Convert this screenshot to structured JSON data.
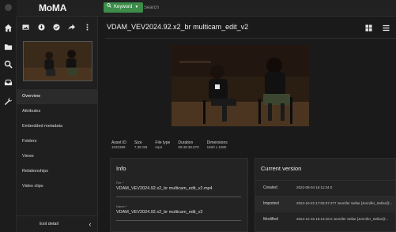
{
  "app": {
    "brand": "MoMA"
  },
  "search": {
    "scope_label": "Keyword",
    "placeholder": "Search"
  },
  "rail": {
    "items": [
      {
        "icon": "home-icon"
      },
      {
        "icon": "folder-icon"
      },
      {
        "icon": "search-icon"
      },
      {
        "icon": "inbox-icon"
      },
      {
        "icon": "tools-icon"
      }
    ]
  },
  "detail_sidebar": {
    "toolbar_icons": [
      "image-icon",
      "download-icon",
      "check-icon",
      "share-icon",
      "more-vertical-icon"
    ],
    "nav": [
      {
        "label": "Overview",
        "active": true
      },
      {
        "label": "Attributes"
      },
      {
        "label": "Embedded metadata"
      },
      {
        "label": "Folders"
      },
      {
        "label": "Views"
      },
      {
        "label": "Relationships"
      },
      {
        "label": "Video clips"
      }
    ],
    "exit_label": "Exit detail",
    "collapse_glyph": "‹"
  },
  "asset": {
    "title": "VDAM_VEV2024.92.x2_br multicam_edit_v2",
    "meta": [
      {
        "label": "Asset ID",
        "value": "1032389"
      },
      {
        "label": "Size",
        "value": "7.38 GB"
      },
      {
        "label": "File type",
        "value": "mp4"
      },
      {
        "label": "Duration",
        "value": "00:48:38.570"
      },
      {
        "label": "Dimensions",
        "value": "1920 x 1080"
      }
    ]
  },
  "info": {
    "title": "Info",
    "file_label": "File",
    "file_value": "VDAM_VEV2024.92.x2_br multicam_edit_v2.mp4",
    "name_label": "Name",
    "name_value": "VDAM_VEV2024.92.x2_br multicam_edit_v2"
  },
  "version": {
    "title": "Current version",
    "rows": [
      {
        "key": "Created",
        "value": "2022-08-04 16:11:34.0"
      },
      {
        "key": "Imported",
        "value": "2024-10-22 17:03:37.277 Jennifer Sellar [Jennifer_Sellar@..."
      },
      {
        "key": "Modified",
        "value": "2024-12-16 15:13:18.0 Jennifer Sellar [Jennifer_Sellar@..."
      }
    ]
  },
  "colors": {
    "accent_green": "#3c8c4a",
    "background": "#1a1a1a"
  }
}
